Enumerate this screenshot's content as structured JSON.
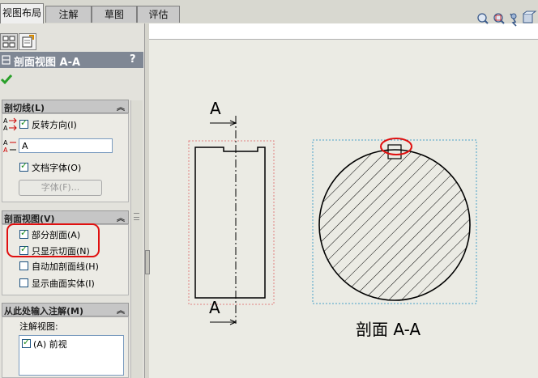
{
  "tabs": [
    {
      "label": "视图布局",
      "active": true
    },
    {
      "label": "注解",
      "active": false
    },
    {
      "label": "草图",
      "active": false
    },
    {
      "label": "评估",
      "active": false
    }
  ],
  "toolbar_icons": [
    "zoom-to-fit-icon",
    "zoom-area-icon",
    "rotate-view-icon",
    "view-settings-icon"
  ],
  "panel": {
    "title": "剖面视图 A-A",
    "help": "?",
    "ok_icon": "check-icon",
    "section_line_group": {
      "header": "剖切线(L)",
      "reverse_direction": {
        "label": "反转方向(I)",
        "checked": true
      },
      "label_value": "A",
      "doc_font": {
        "label": "文档字体(O)",
        "checked": true
      },
      "font_button": "字体(F)..."
    },
    "section_view_group": {
      "header": "剖面视图(V)",
      "partial_section": {
        "label": "部分剖面(A)",
        "checked": true
      },
      "display_only_surface": {
        "label": "只显示切面(N)",
        "checked": true
      },
      "auto_hatching": {
        "label": "自动加剖面线(H)",
        "checked": false
      },
      "display_surface_bodies": {
        "label": "显示曲面实体(I)",
        "checked": false
      }
    },
    "import_annotations_group": {
      "header": "从此处输入注解(M)",
      "list_label": "注解视图:",
      "items": [
        {
          "label": "(A) 前视",
          "checked": true
        }
      ]
    }
  },
  "drawing": {
    "section_letter_top": "A",
    "section_letter_bottom": "A",
    "section_view_label": "剖面 A-A"
  },
  "colors": {
    "highlight": "#e01010",
    "accent_blue": "#1c5180",
    "title_bar": "#7f8794"
  }
}
